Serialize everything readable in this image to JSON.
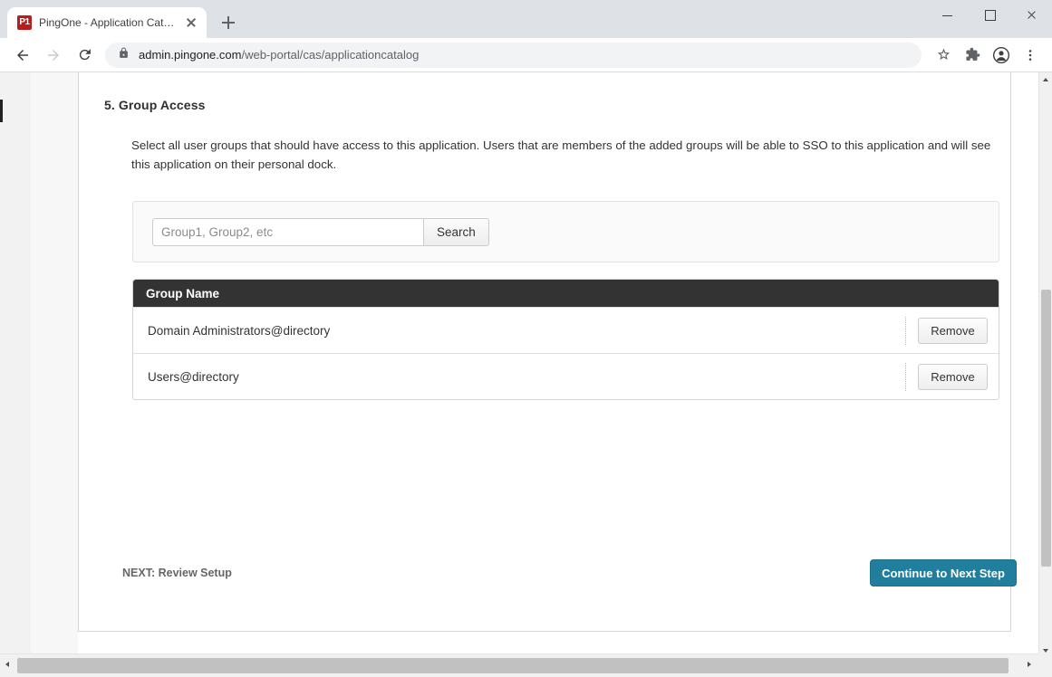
{
  "browser": {
    "tab": {
      "favicon_text": "P1",
      "favicon_color": "#b91c1c",
      "title": "PingOne - Application Catalog",
      "close_icon": "close-icon"
    },
    "new_tab_icon": "plus-icon",
    "window_controls": {
      "minimize": "minimize-icon",
      "maximize": "maximize-icon",
      "close": "close-icon"
    },
    "toolbar": {
      "back_icon": "back-arrow-icon",
      "forward_icon": "forward-arrow-icon",
      "reload_icon": "reload-icon",
      "lock_icon": "lock-icon",
      "url_host": "admin.pingone.com",
      "url_path": "/web-portal/cas/applicationcatalog",
      "bookmark_icon": "star-icon",
      "extensions_icon": "puzzle-piece-icon",
      "profile_icon": "account-avatar-icon",
      "menu_icon": "three-dot-menu-icon"
    }
  },
  "page": {
    "section_title": "5. Group Access",
    "section_description": "Select all user groups that should have access to this application. Users that are members of the added groups will be able to SSO to this application and will see this application on their personal dock.",
    "search": {
      "placeholder": "Group1, Group2, etc",
      "value": "",
      "button_label": "Search"
    },
    "table": {
      "columns": [
        "Group Name"
      ],
      "rows": [
        {
          "group_name": "Domain Administrators@directory",
          "action_label": "Remove"
        },
        {
          "group_name": "Users@directory",
          "action_label": "Remove"
        }
      ]
    },
    "footer": {
      "next_label": "NEXT: Review Setup",
      "continue_label": "Continue to Next Step",
      "continue_color": "#217e9c"
    }
  }
}
